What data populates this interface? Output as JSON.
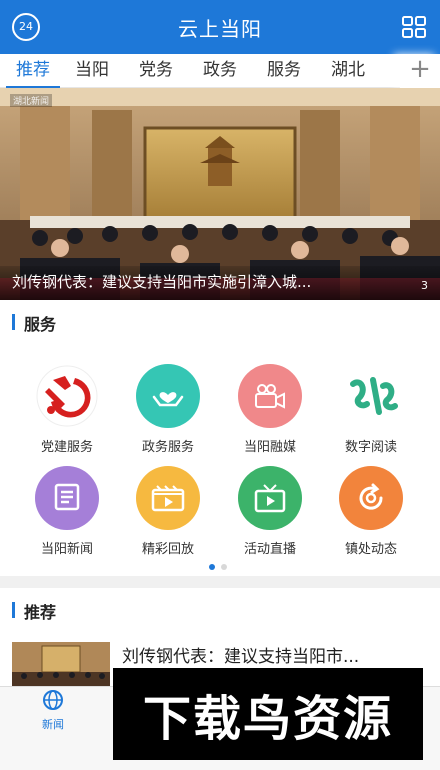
{
  "header": {
    "title": "云上当阳",
    "clock_label": "24"
  },
  "tabs": [
    {
      "label": "推荐"
    },
    {
      "label": "当阳"
    },
    {
      "label": "党务"
    },
    {
      "label": "政务"
    },
    {
      "label": "服务"
    },
    {
      "label": "湖北"
    }
  ],
  "tab_more_label": "+",
  "banner": {
    "caption": "刘传钢代表：建议支持当阳市实施引漳入城...",
    "page_indicator": "3",
    "tag": "湖北新闻"
  },
  "services_section": {
    "title": "服务",
    "items": [
      {
        "label": "党建服务",
        "color": "#ffffff",
        "icon": "party-emblem-icon"
      },
      {
        "label": "政务服务",
        "color": "#35c6b4",
        "icon": "heart-hands-icon"
      },
      {
        "label": "当阳融媒",
        "color": "#f0888a",
        "icon": "video-camera-icon"
      },
      {
        "label": "数字阅读",
        "color": "#ffffff",
        "icon": "calligraphy-icon"
      },
      {
        "label": "当阳新闻",
        "color": "#a57fd8",
        "icon": "document-icon"
      },
      {
        "label": "精彩回放",
        "color": "#f6b940",
        "icon": "playback-icon"
      },
      {
        "label": "活动直播",
        "color": "#3cb36a",
        "icon": "tv-play-icon"
      },
      {
        "label": "镇处动态",
        "color": "#f2843c",
        "icon": "refresh-icon"
      }
    ],
    "pager": {
      "pages": 2,
      "current": 1
    }
  },
  "recommend_section": {
    "title": "推荐",
    "items": [
      {
        "title": "刘传钢代表：建议支持当阳市..."
      }
    ]
  },
  "bottom_nav": {
    "items": [
      {
        "label": "新闻",
        "icon": "globe-icon"
      }
    ]
  },
  "watermark": {
    "text": "下载鸟资源"
  },
  "colors": {
    "primary": "#1e78d8",
    "party_red": "#d6201f"
  }
}
